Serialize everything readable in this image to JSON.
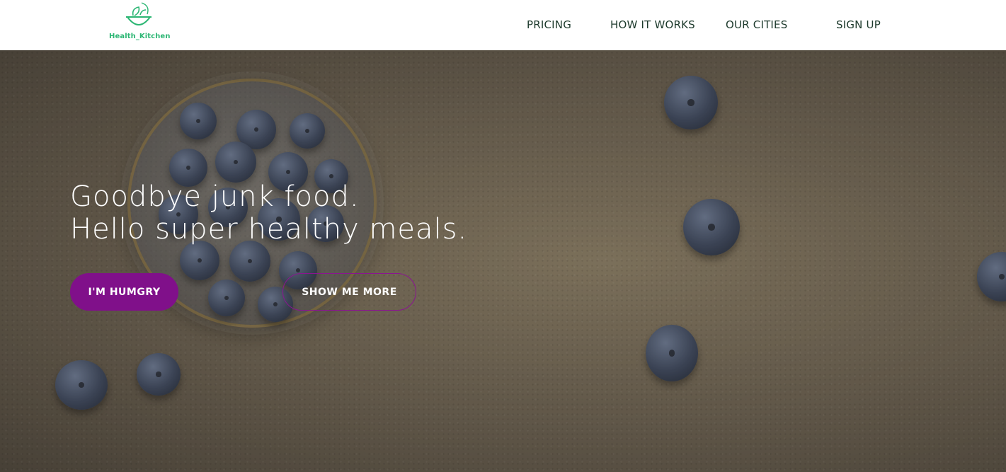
{
  "brand": {
    "name": "Health_Kitchen",
    "color": "#2bb673",
    "icon": "bowl-leaf-icon"
  },
  "nav": {
    "items": [
      {
        "label": "PRICING"
      },
      {
        "label": "HOW IT WORKS"
      },
      {
        "label": "OUR CITIES"
      },
      {
        "label": "SIGN UP"
      }
    ]
  },
  "hero": {
    "headline_line1": "Goodbye junk food.",
    "headline_line2": "Hello super healthy meals.",
    "primary_button": "I'M HUMGRY",
    "secondary_button": "SHOW ME MORE",
    "accent_color": "#80108a",
    "background_image": "blueberries-on-textured-surface"
  }
}
